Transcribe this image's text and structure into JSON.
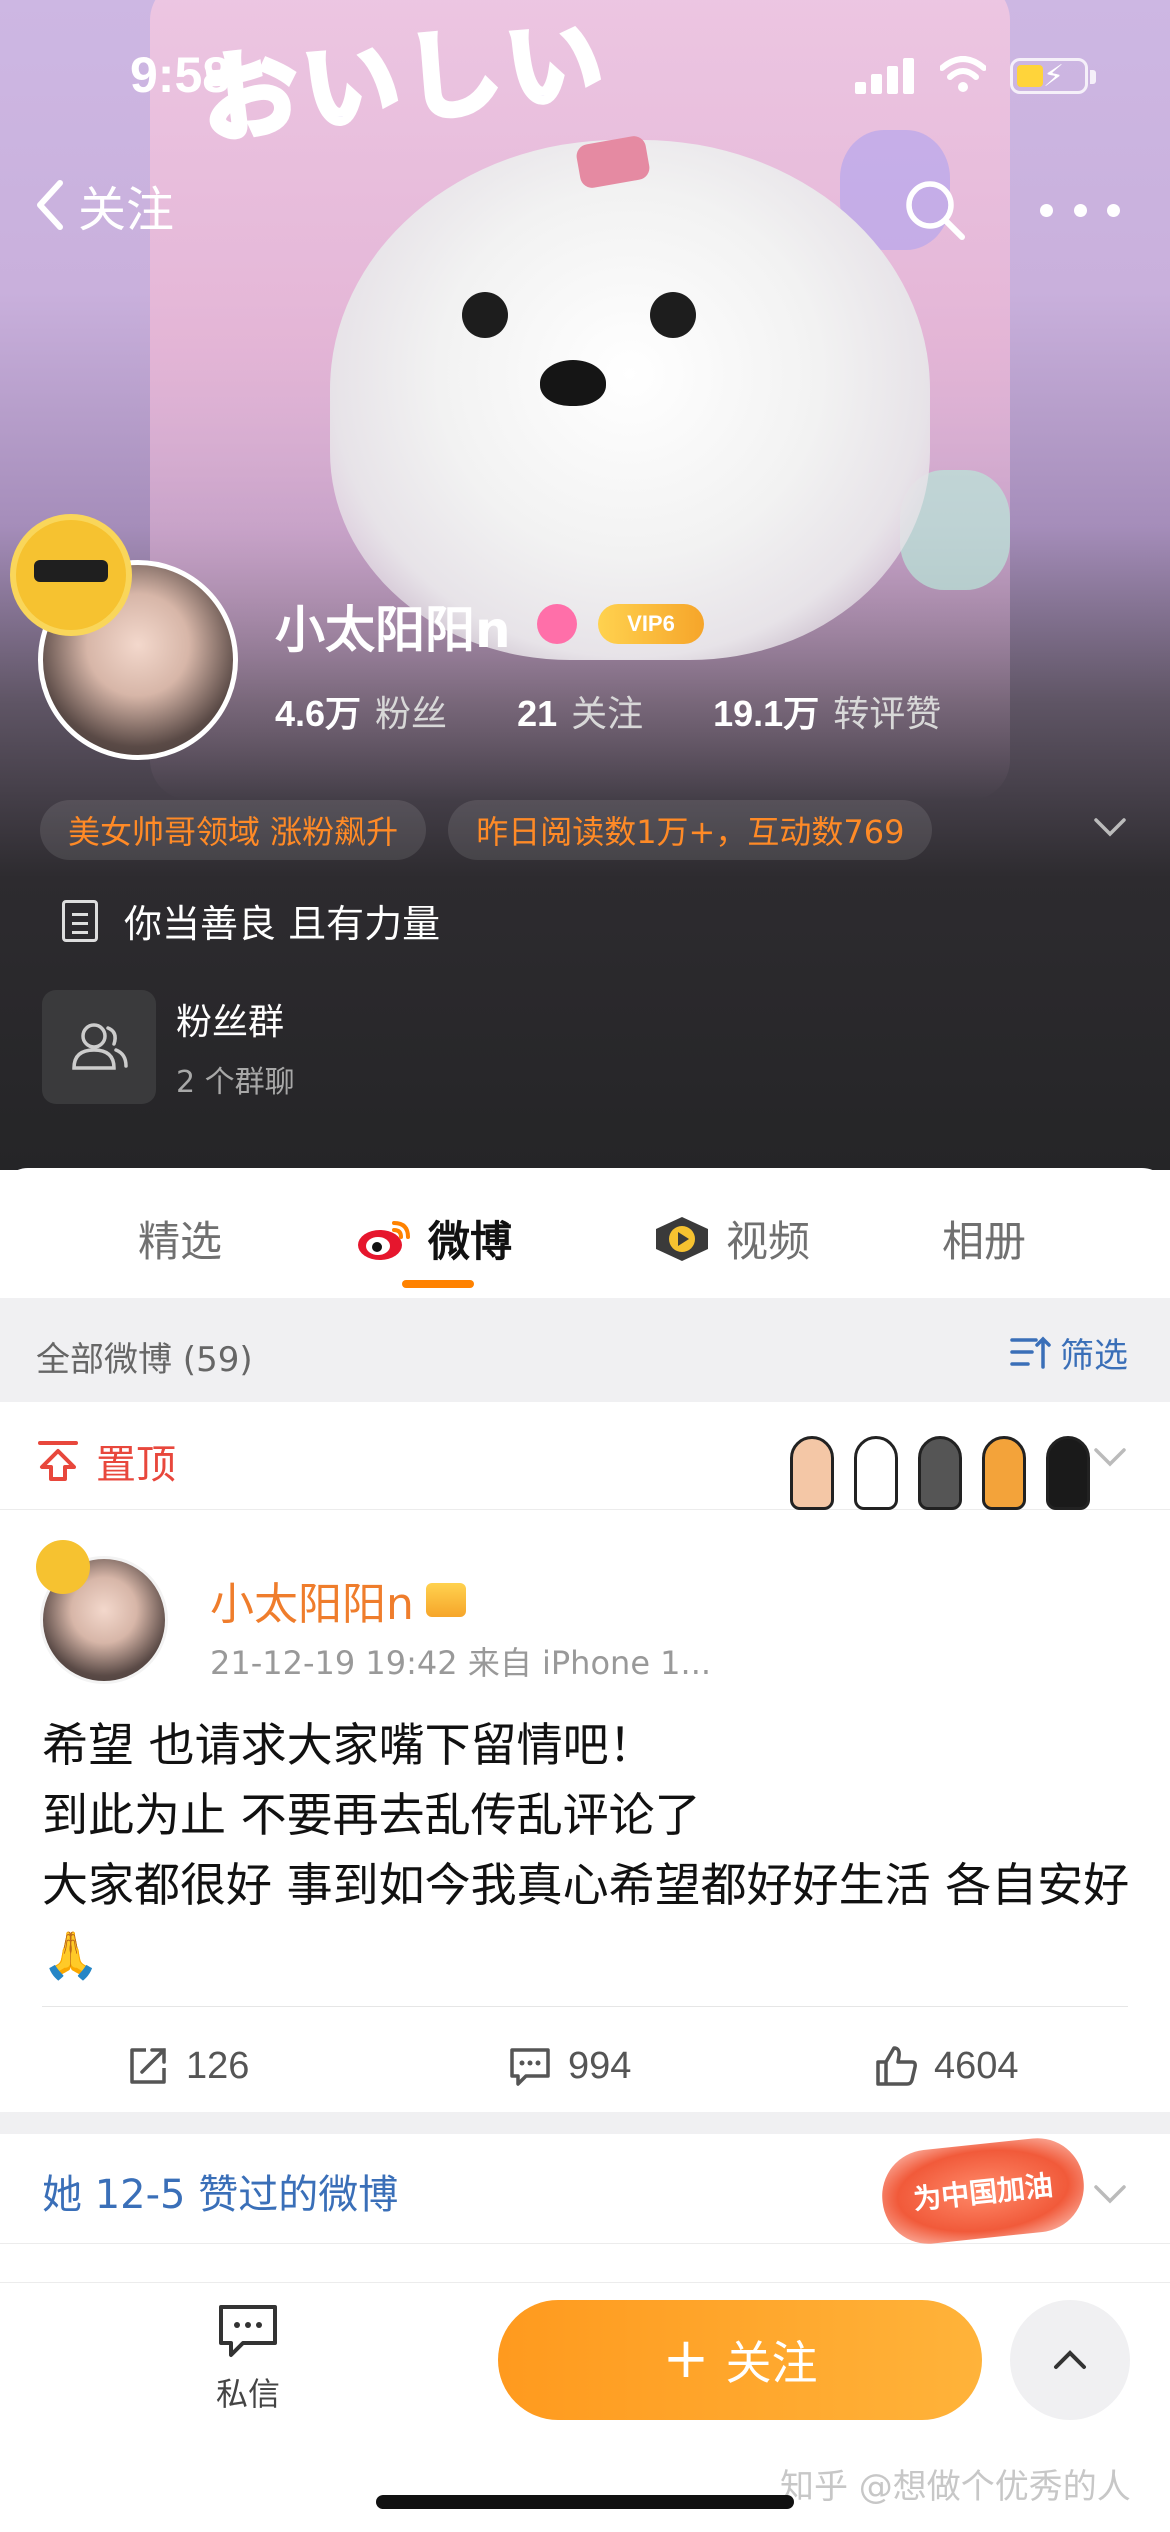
{
  "status_bar": {
    "time": "9:58"
  },
  "nav": {
    "back_label": "关注"
  },
  "banner": {
    "text": "おいしい"
  },
  "profile": {
    "username": "小太阳阳n",
    "vip_label": "VIP6",
    "stats": [
      {
        "value": "4.6万",
        "label": "粉丝"
      },
      {
        "value": "21",
        "label": "关注"
      },
      {
        "value": "19.1万",
        "label": "转评赞"
      }
    ],
    "tags": [
      "美女帅哥领域 涨粉飙升",
      "昨日阅读数1万+，互动数769"
    ],
    "bio": "你当善良 且有力量",
    "fans_group": {
      "title": "粉丝群",
      "subtitle": "2 个群聊"
    }
  },
  "tabs": [
    {
      "label": "精选",
      "active": false
    },
    {
      "label": "微博",
      "active": true
    },
    {
      "label": "视频",
      "active": false
    },
    {
      "label": "相册",
      "active": false
    }
  ],
  "filter": {
    "count_label": "全部微博 (59)",
    "filter_label": "筛选"
  },
  "pinned": {
    "label": "置顶"
  },
  "post": {
    "author": "小太阳阳n",
    "meta": "21-12-19 19:42  来自 iPhone 1...",
    "lines": [
      "希望 也请求大家嘴下留情吧！",
      "到此为止 不要再去乱传乱评论了",
      "大家都很好 事到如今我真心希望都好好生活 各自安好🙏"
    ],
    "reposts": "126",
    "comments": "994",
    "likes": "4604"
  },
  "liked_section": {
    "label": "她 12-5 赞过的微博",
    "badge": "为中国加油"
  },
  "bottom_bar": {
    "dm_label": "私信",
    "follow_label": "关注"
  },
  "watermark": "知乎 @想做个优秀的人",
  "colors": {
    "accent": "#ff8200",
    "link_blue": "#3a6fb8",
    "pinned_red": "#e8473c",
    "tag_orange": "#ff8a26"
  }
}
